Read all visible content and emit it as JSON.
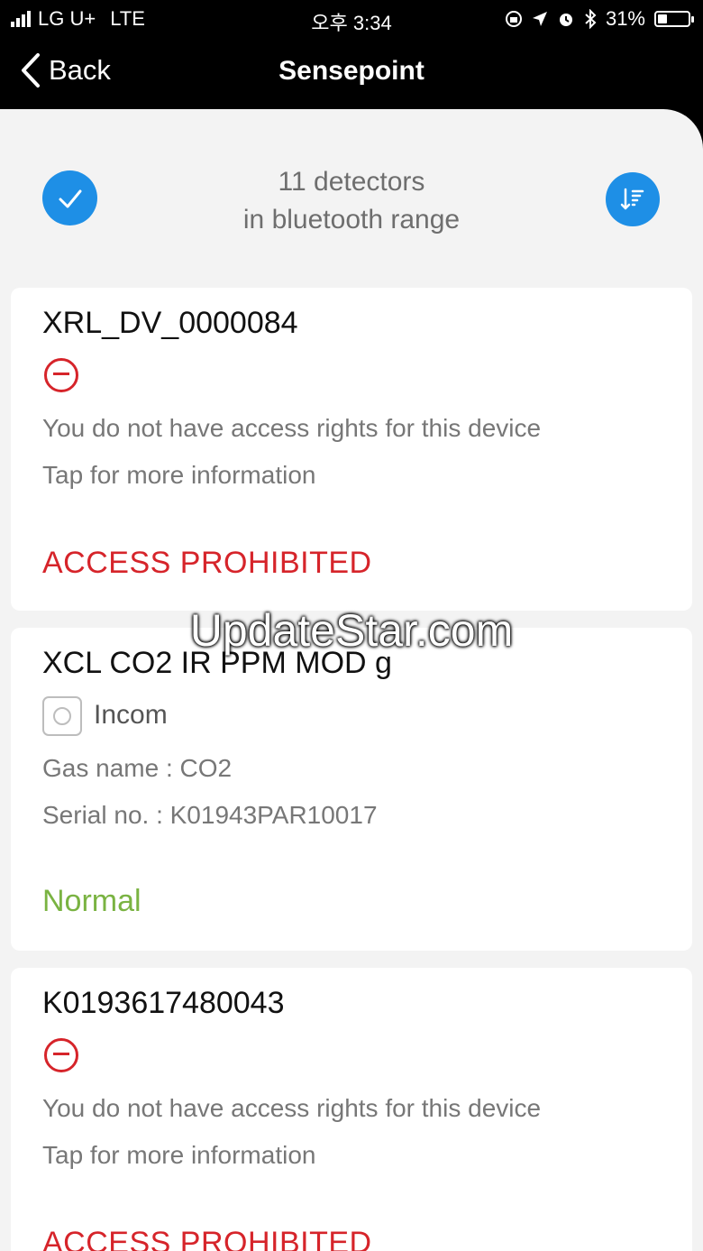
{
  "status_bar": {
    "carrier": "LG U+",
    "network": "LTE",
    "time": "오후 3:34",
    "battery": "31%",
    "battery_level": 0.31
  },
  "nav": {
    "back_label": "Back",
    "title": "Sensepoint"
  },
  "header": {
    "range_line1": "11 detectors",
    "range_line2": "in bluetooth range"
  },
  "devices": [
    {
      "name": "XRL_DV_0000084",
      "line1": "You do not have access rights for this device",
      "line2": "Tap for more information",
      "status": "ACCESS PROHIBITED"
    },
    {
      "name": "XCL CO2 IR PPM MOD g",
      "comm": "Incom",
      "line1": "Gas name : CO2",
      "line2": "Serial no. : K01943PAR10017",
      "status": "Normal"
    },
    {
      "name": "K0193617480043",
      "line1": "You do not have access rights for this device",
      "line2": "Tap for more information",
      "status": "ACCESS PROHIBITED"
    }
  ],
  "watermark": "UpdateStar.com",
  "colors": {
    "accent": "#1e8fe6",
    "prohibited": "#d6242a",
    "normal": "#7ab342"
  }
}
